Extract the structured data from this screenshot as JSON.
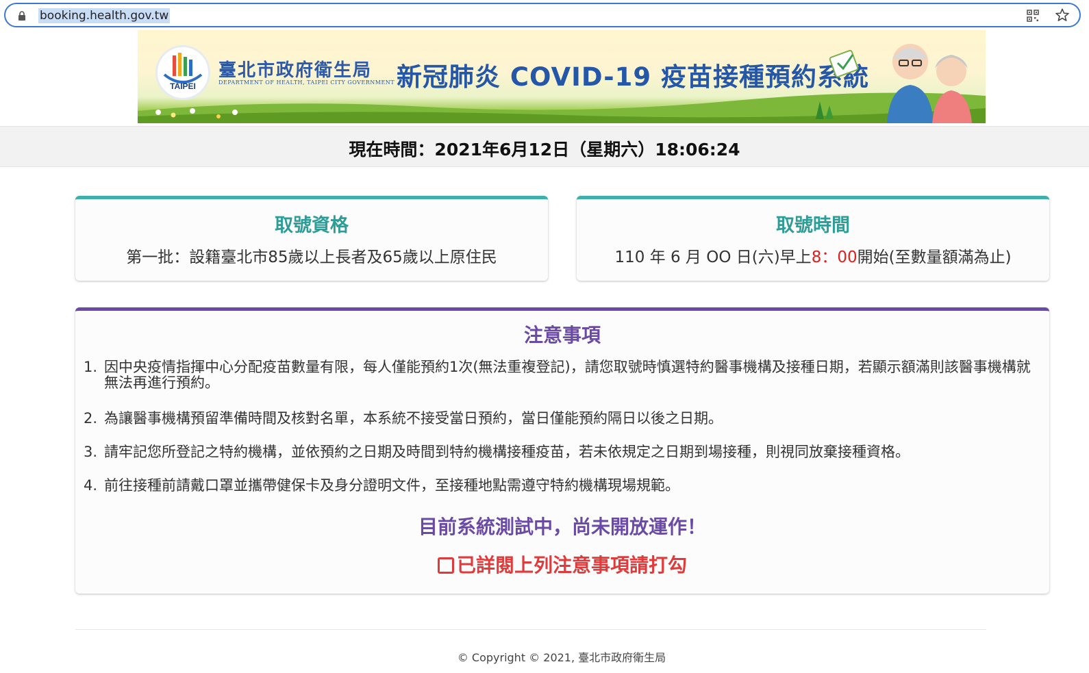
{
  "browser": {
    "url": "booking.health.gov.tw",
    "icons": [
      "lock-icon",
      "qr-code-icon",
      "star-icon"
    ]
  },
  "banner": {
    "logo_text": "TAIPEI",
    "org_name": "臺北市政府衛生局",
    "org_name_en": "DEPARTMENT OF HEALTH, TAIPEI CITY GOVERNMENT",
    "system_title": "新冠肺炎 COVID-19 疫苗接種預約系統"
  },
  "current_time": "現在時間：2021年6月12日（星期六）18:06:24",
  "eligibility": {
    "title": "取號資格",
    "text": "第一批：設籍臺北市85歲以上長者及65歲以上原住民"
  },
  "booking_time": {
    "title": "取號時間",
    "prefix": "110 年 6 月 OO 日(六)早上",
    "time_highlight": "8：00",
    "suffix": "開始(至數量額滿為止)"
  },
  "notice": {
    "title": "注意事項",
    "items": [
      {
        "num": "1.",
        "text": "因中央疫情指揮中心分配疫苗數量有限，每人僅能預約1次(無法重複登記)，請您取號時慎選特約醫事機構及接種日期，若顯示額滿則該醫事機構就無法再進行預約。"
      },
      {
        "num": "2.",
        "text": "為讓醫事機構預留準備時間及核對名單，本系統不接受當日預約，當日僅能預約隔日以後之日期。"
      },
      {
        "num": "3.",
        "text": "請牢記您所登記之特約機構，並依預約之日期及時間到特約機構接種疫苗，若未依規定之日期到場接種，則視同放棄接種資格。"
      },
      {
        "num": "4.",
        "text": "前往接種前請戴口罩並攜帶健保卡及身分證明文件，至接種地點需遵守特約機構現場規範。"
      }
    ],
    "testing_notice": "目前系統測試中，尚未開放運作！",
    "agree_label": "已詳閱上列注意事項請打勾"
  },
  "footer": {
    "copyright": "© Copyright © 2021, 臺北市政府衛生局"
  },
  "colors": {
    "teal": "#3db0ab",
    "purple": "#6a4aa6",
    "red": "#e02020",
    "banner_blue": "#2457a8"
  }
}
